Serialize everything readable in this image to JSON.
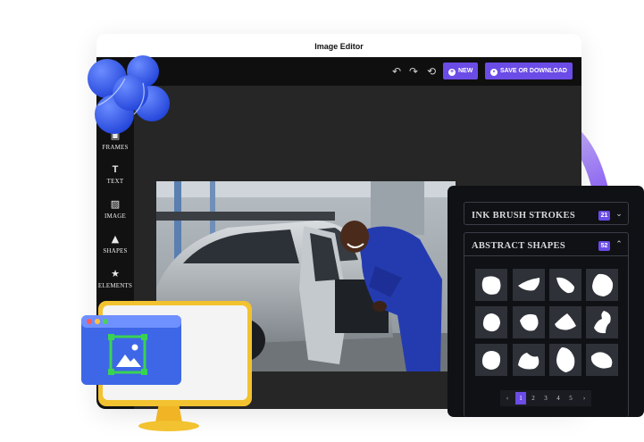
{
  "window": {
    "title": "Image Editor"
  },
  "toolbar": {
    "new_label": "NEW",
    "save_label": "SAVE OR DOWNLOAD"
  },
  "sidebar": {
    "items": [
      {
        "label": "FRAMES"
      },
      {
        "label": "TEXT"
      },
      {
        "label": "IMAGE"
      },
      {
        "label": "SHAPES"
      },
      {
        "label": "ELEMENTS"
      }
    ]
  },
  "panel": {
    "sections": [
      {
        "title": "INK BRUSH STROKES",
        "count": "21",
        "expanded": false
      },
      {
        "title": "ABSTRACT SHAPES",
        "count": "52",
        "expanded": true
      }
    ],
    "pagination": {
      "pages": [
        "1",
        "2",
        "3",
        "4",
        "5"
      ],
      "current": "1"
    }
  },
  "colors": {
    "accent": "#6b4ce6",
    "dark": "#0f1115",
    "deco_blue": "#2f5bea",
    "deco_yellow": "#f2c230"
  }
}
